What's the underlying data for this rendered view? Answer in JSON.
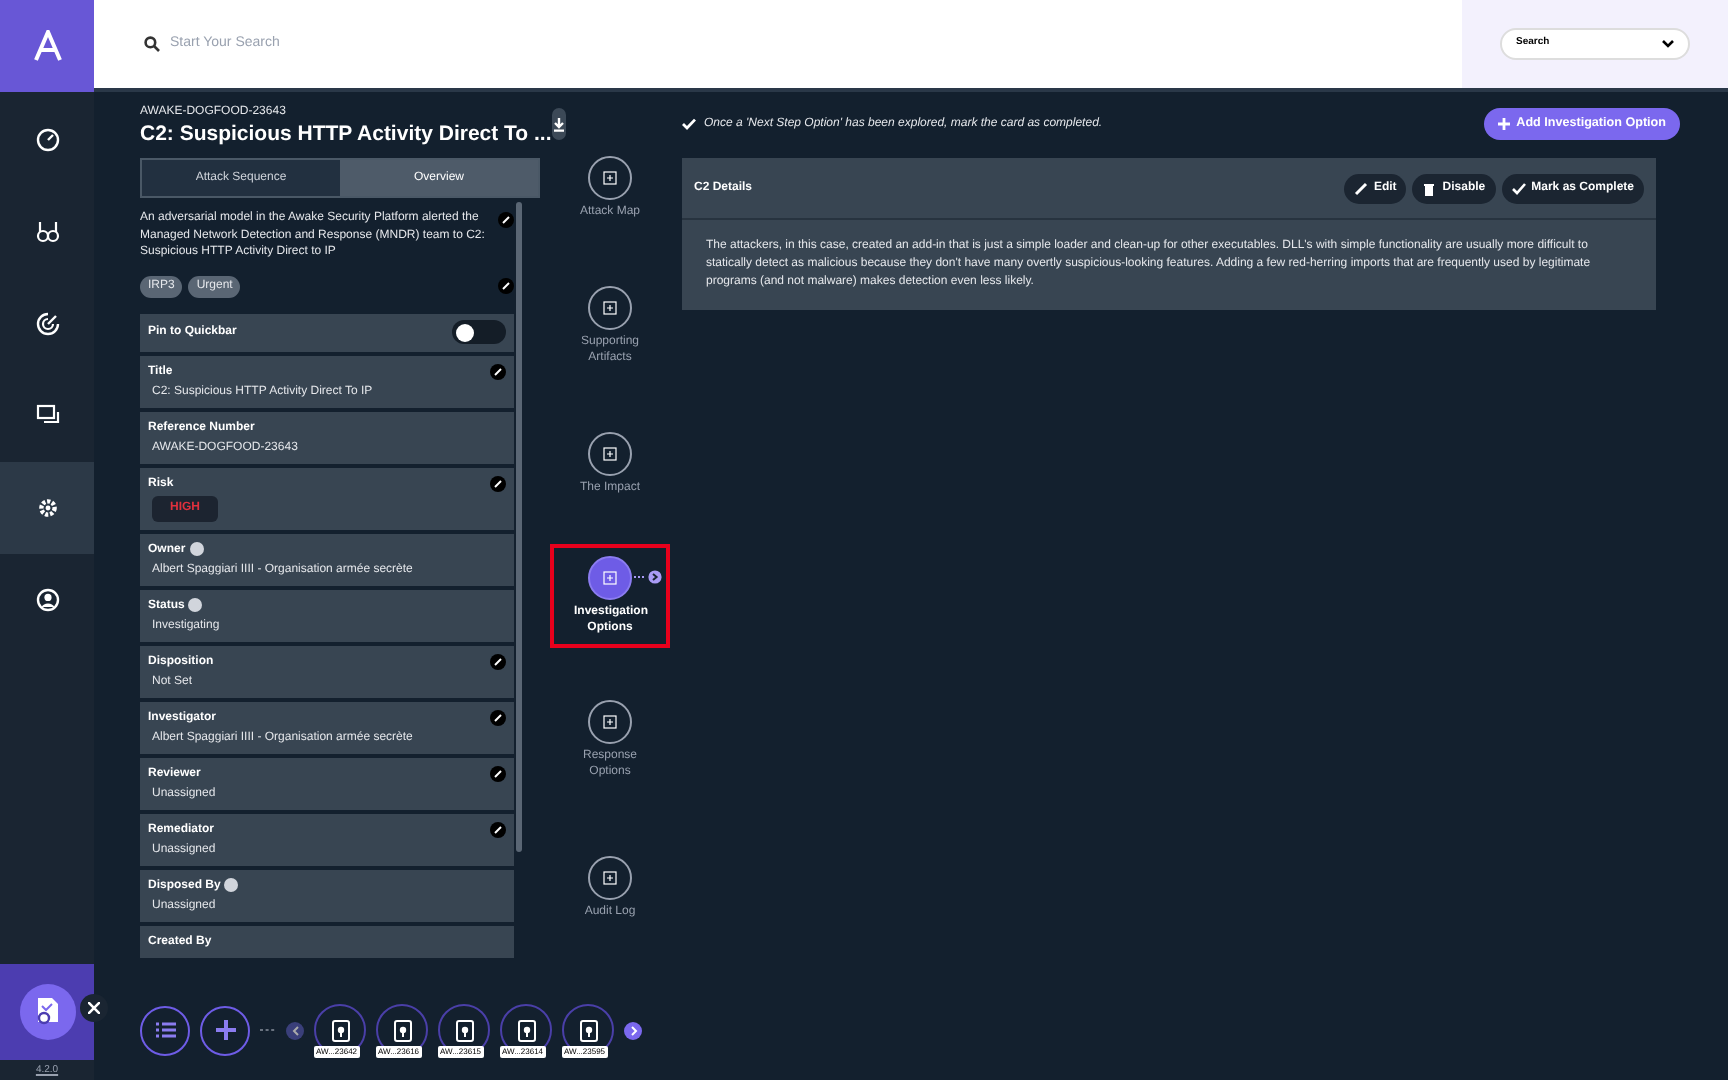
{
  "search": {
    "placeholder": "Start Your Search",
    "scope": "Search"
  },
  "nav": [
    {
      "selected": false
    },
    {
      "selected": false
    },
    {
      "selected": false
    },
    {
      "selected": false
    },
    {
      "selected": true
    },
    {
      "selected": false
    }
  ],
  "version": "4.2.0",
  "case": {
    "id": "AWAKE-DOGFOOD-23643",
    "title": "C2: Suspicious HTTP Activity Direct To ...",
    "tabs": [
      {
        "label": "Attack Sequence",
        "selected": false
      },
      {
        "label": "Overview",
        "selected": true
      }
    ],
    "description": "An adversarial model in the Awake Security Platform alerted the Managed Network Detection and Response (MNDR) team to C2: Suspicious HTTP Activity Direct to IP",
    "tags": [
      "IRP3",
      "Urgent"
    ],
    "pin": {
      "label": "Pin to Quickbar",
      "on": false
    },
    "fields": [
      {
        "kind": "text",
        "label": "Title",
        "value": "C2: Suspicious HTTP Activity Direct To IP",
        "editable": true,
        "info": false
      },
      {
        "kind": "text",
        "label": "Reference Number",
        "value": "AWAKE-DOGFOOD-23643",
        "editable": false,
        "info": false
      },
      {
        "kind": "risk",
        "label": "Risk",
        "value": "HIGH",
        "editable": true,
        "info": false
      },
      {
        "kind": "text",
        "label": "Owner",
        "value": "Albert Spaggiari IIII - Organisation armée secrète",
        "editable": false,
        "info": true
      },
      {
        "kind": "text",
        "label": "Status",
        "value": "Investigating",
        "editable": false,
        "info": true
      },
      {
        "kind": "text",
        "label": "Disposition",
        "value": "Not Set",
        "editable": true,
        "info": false
      },
      {
        "kind": "text",
        "label": "Investigator",
        "value": "Albert Spaggiari IIII - Organisation armée secrète",
        "editable": true,
        "info": false
      },
      {
        "kind": "text",
        "label": "Reviewer",
        "value": "Unassigned",
        "editable": true,
        "info": false
      },
      {
        "kind": "text",
        "label": "Remediator",
        "value": "Unassigned",
        "editable": true,
        "info": false
      },
      {
        "kind": "text",
        "label": "Disposed By",
        "value": "Unassigned",
        "editable": false,
        "info": true
      },
      {
        "label": "Created By",
        "editable": false,
        "info": false
      }
    ]
  },
  "steps": [
    {
      "label": "Attack Map",
      "selected": false
    },
    {
      "label": "Supporting Artifacts",
      "selected": false
    },
    {
      "label": "The Impact",
      "selected": false
    },
    {
      "label": "Investigation Options",
      "selected": true
    },
    {
      "label": "Response Options",
      "selected": false
    },
    {
      "label": "Audit Log",
      "selected": false
    }
  ],
  "note": "Once a 'Next Step Option' has been explored, mark the card as completed.",
  "add_button": "Add Investigation Option",
  "card": {
    "title": "C2 Details",
    "actions": [
      {
        "kind": "edit",
        "label": "Edit"
      },
      {
        "kind": "disable",
        "label": "Disable"
      },
      {
        "kind": "complete",
        "label": "Mark as Complete"
      }
    ],
    "body": "The attackers, in this case, created an add-in that is just a simple loader and clean-up for other executables. DLL's with simple functionality are usually more difficult to statically detect as malicious because they don't have many overtly suspicious-looking features. Adding a few red-herring imports that are frequently used by legitimate programs (and not malware) makes detection even less likely."
  },
  "quickbar": {
    "cases": [
      "AW...23642",
      "AW...23616",
      "AW...23615",
      "AW...23614",
      "AW...23595"
    ]
  }
}
